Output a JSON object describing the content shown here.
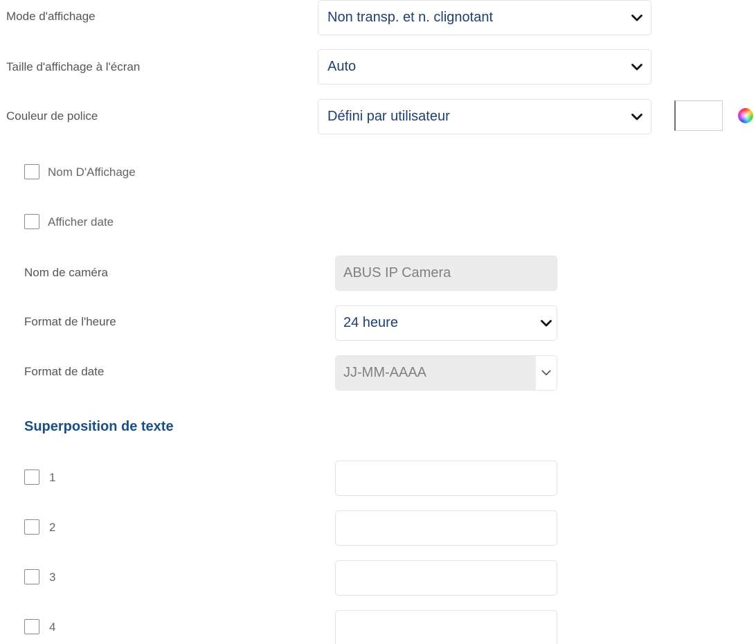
{
  "display_settings": {
    "display_mode": {
      "label": "Mode d'affichage",
      "value": "Non transp. et n. clignotant"
    },
    "display_size": {
      "label": "Taille d'affichage à l'écran",
      "value": "Auto"
    },
    "font_color": {
      "label": "Couleur de police",
      "value": "Défini par utilisateur",
      "color_swatch": "#ffffff"
    }
  },
  "options": {
    "show_name": {
      "label": "Nom D'Affichage",
      "checked": false
    },
    "show_date": {
      "label": "Afficher date",
      "checked": false
    }
  },
  "camera": {
    "name_label": "Nom de caméra",
    "name_value": "ABUS IP Camera",
    "time_format_label": "Format de l'heure",
    "time_format_value": "24 heure",
    "date_format_label": "Format de date",
    "date_format_value": "JJ-MM-AAAA"
  },
  "text_overlay": {
    "title": "Superposition de texte",
    "items": [
      {
        "label": "1",
        "checked": false,
        "value": ""
      },
      {
        "label": "2",
        "checked": false,
        "value": ""
      },
      {
        "label": "3",
        "checked": false,
        "value": ""
      },
      {
        "label": "4",
        "checked": false,
        "value": ""
      }
    ]
  },
  "colors": {
    "value_text": "#1f3f6e",
    "section_title": "#1a4f86",
    "label_text": "#555555",
    "disabled_bg": "#ececec"
  },
  "icons": {
    "dropdown": "chevron-down-icon",
    "color_picker": "color-wheel-icon"
  }
}
